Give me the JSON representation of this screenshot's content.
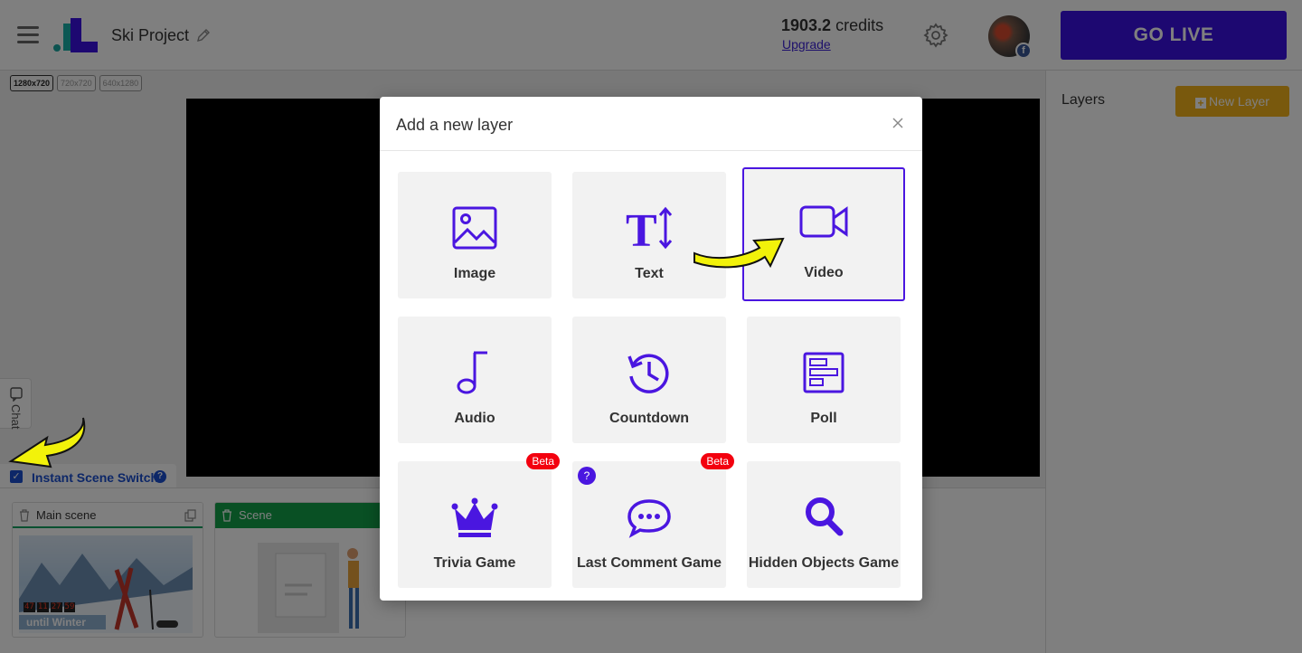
{
  "header": {
    "project_name": "Ski Project",
    "credits_value": "1903.2",
    "credits_unit": "credits",
    "upgrade_label": "Upgrade",
    "golive_label": "GO LIVE",
    "avatar_badge": "f"
  },
  "resolutions": [
    "1280x720",
    "720x720",
    "640x1280"
  ],
  "chat": {
    "label": "Chat"
  },
  "instant_scene_switch": {
    "label": "Instant Scene Switch",
    "checked": true,
    "help": "?"
  },
  "scenes": [
    {
      "label": "Main scene",
      "thumbnail_caption": "until Winter",
      "timer": [
        "47",
        "11",
        "27",
        "59"
      ]
    },
    {
      "label": "Scene"
    }
  ],
  "layers_panel": {
    "title": "Layers",
    "new_layer_label": "New Layer"
  },
  "modal": {
    "title": "Add a new layer",
    "tiles": [
      {
        "label": "Image",
        "icon": "image-icon"
      },
      {
        "label": "Text",
        "icon": "text-icon",
        "glyph": "T"
      },
      {
        "label": "Video",
        "icon": "video-camera-icon",
        "selected": true
      },
      {
        "label": "Audio",
        "icon": "music-note-icon"
      },
      {
        "label": "Countdown",
        "icon": "history-clock-icon"
      },
      {
        "label": "Poll",
        "icon": "poll-icon"
      },
      {
        "label": "Trivia Game",
        "icon": "crown-icon",
        "badge": "Beta"
      },
      {
        "label": "Last Comment Game",
        "icon": "comment-dots-icon",
        "badge": "Beta",
        "help": "?"
      },
      {
        "label": "Hidden Objects Game",
        "icon": "magnifier-icon"
      }
    ]
  },
  "colors": {
    "primary": "#3b10e3",
    "icon_purple": "#4a16e0",
    "new_layer_yellow": "#f2b21b",
    "beta_red": "#f3010f",
    "scene_green": "#12a048",
    "link_blue": "#1a4fd1"
  }
}
